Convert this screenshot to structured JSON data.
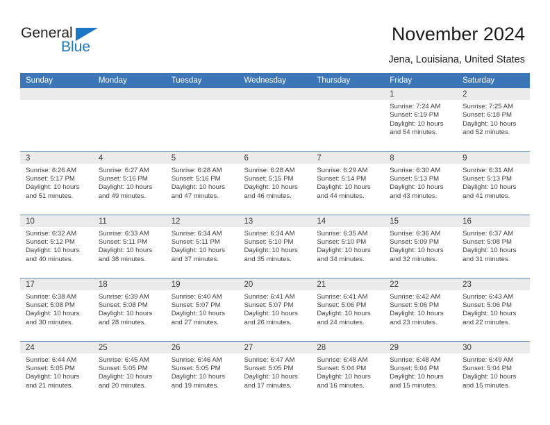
{
  "brand": {
    "name_part1": "General",
    "name_part2": "Blue",
    "logo_icon": "triangle-icon",
    "accent_color": "#1b77c4"
  },
  "header": {
    "title": "November 2024",
    "location": "Jena, Louisiana, United States"
  },
  "theme": {
    "header_blue": "#3a76b8",
    "daynum_band": "#ebebeb",
    "row_divider": "#5b87b8",
    "text": "#3c3c3c"
  },
  "calendar": {
    "weekday_headers": [
      "Sunday",
      "Monday",
      "Tuesday",
      "Wednesday",
      "Thursday",
      "Friday",
      "Saturday"
    ],
    "weeks": [
      [
        {
          "day": "",
          "empty": true
        },
        {
          "day": "",
          "empty": true
        },
        {
          "day": "",
          "empty": true
        },
        {
          "day": "",
          "empty": true
        },
        {
          "day": "",
          "empty": true
        },
        {
          "day": "1",
          "sunrise": "Sunrise: 7:24 AM",
          "sunset": "Sunset: 6:19 PM",
          "daylight1": "Daylight: 10 hours",
          "daylight2": "and 54 minutes."
        },
        {
          "day": "2",
          "sunrise": "Sunrise: 7:25 AM",
          "sunset": "Sunset: 6:18 PM",
          "daylight1": "Daylight: 10 hours",
          "daylight2": "and 52 minutes."
        }
      ],
      [
        {
          "day": "3",
          "sunrise": "Sunrise: 6:26 AM",
          "sunset": "Sunset: 5:17 PM",
          "daylight1": "Daylight: 10 hours",
          "daylight2": "and 51 minutes."
        },
        {
          "day": "4",
          "sunrise": "Sunrise: 6:27 AM",
          "sunset": "Sunset: 5:16 PM",
          "daylight1": "Daylight: 10 hours",
          "daylight2": "and 49 minutes."
        },
        {
          "day": "5",
          "sunrise": "Sunrise: 6:28 AM",
          "sunset": "Sunset: 5:16 PM",
          "daylight1": "Daylight: 10 hours",
          "daylight2": "and 47 minutes."
        },
        {
          "day": "6",
          "sunrise": "Sunrise: 6:28 AM",
          "sunset": "Sunset: 5:15 PM",
          "daylight1": "Daylight: 10 hours",
          "daylight2": "and 46 minutes."
        },
        {
          "day": "7",
          "sunrise": "Sunrise: 6:29 AM",
          "sunset": "Sunset: 5:14 PM",
          "daylight1": "Daylight: 10 hours",
          "daylight2": "and 44 minutes."
        },
        {
          "day": "8",
          "sunrise": "Sunrise: 6:30 AM",
          "sunset": "Sunset: 5:13 PM",
          "daylight1": "Daylight: 10 hours",
          "daylight2": "and 43 minutes."
        },
        {
          "day": "9",
          "sunrise": "Sunrise: 6:31 AM",
          "sunset": "Sunset: 5:13 PM",
          "daylight1": "Daylight: 10 hours",
          "daylight2": "and 41 minutes."
        }
      ],
      [
        {
          "day": "10",
          "sunrise": "Sunrise: 6:32 AM",
          "sunset": "Sunset: 5:12 PM",
          "daylight1": "Daylight: 10 hours",
          "daylight2": "and 40 minutes."
        },
        {
          "day": "11",
          "sunrise": "Sunrise: 6:33 AM",
          "sunset": "Sunset: 5:11 PM",
          "daylight1": "Daylight: 10 hours",
          "daylight2": "and 38 minutes."
        },
        {
          "day": "12",
          "sunrise": "Sunrise: 6:34 AM",
          "sunset": "Sunset: 5:11 PM",
          "daylight1": "Daylight: 10 hours",
          "daylight2": "and 37 minutes."
        },
        {
          "day": "13",
          "sunrise": "Sunrise: 6:34 AM",
          "sunset": "Sunset: 5:10 PM",
          "daylight1": "Daylight: 10 hours",
          "daylight2": "and 35 minutes."
        },
        {
          "day": "14",
          "sunrise": "Sunrise: 6:35 AM",
          "sunset": "Sunset: 5:10 PM",
          "daylight1": "Daylight: 10 hours",
          "daylight2": "and 34 minutes."
        },
        {
          "day": "15",
          "sunrise": "Sunrise: 6:36 AM",
          "sunset": "Sunset: 5:09 PM",
          "daylight1": "Daylight: 10 hours",
          "daylight2": "and 32 minutes."
        },
        {
          "day": "16",
          "sunrise": "Sunrise: 6:37 AM",
          "sunset": "Sunset: 5:08 PM",
          "daylight1": "Daylight: 10 hours",
          "daylight2": "and 31 minutes."
        }
      ],
      [
        {
          "day": "17",
          "sunrise": "Sunrise: 6:38 AM",
          "sunset": "Sunset: 5:08 PM",
          "daylight1": "Daylight: 10 hours",
          "daylight2": "and 30 minutes."
        },
        {
          "day": "18",
          "sunrise": "Sunrise: 6:39 AM",
          "sunset": "Sunset: 5:08 PM",
          "daylight1": "Daylight: 10 hours",
          "daylight2": "and 28 minutes."
        },
        {
          "day": "19",
          "sunrise": "Sunrise: 6:40 AM",
          "sunset": "Sunset: 5:07 PM",
          "daylight1": "Daylight: 10 hours",
          "daylight2": "and 27 minutes."
        },
        {
          "day": "20",
          "sunrise": "Sunrise: 6:41 AM",
          "sunset": "Sunset: 5:07 PM",
          "daylight1": "Daylight: 10 hours",
          "daylight2": "and 26 minutes."
        },
        {
          "day": "21",
          "sunrise": "Sunrise: 6:41 AM",
          "sunset": "Sunset: 5:06 PM",
          "daylight1": "Daylight: 10 hours",
          "daylight2": "and 24 minutes."
        },
        {
          "day": "22",
          "sunrise": "Sunrise: 6:42 AM",
          "sunset": "Sunset: 5:06 PM",
          "daylight1": "Daylight: 10 hours",
          "daylight2": "and 23 minutes."
        },
        {
          "day": "23",
          "sunrise": "Sunrise: 6:43 AM",
          "sunset": "Sunset: 5:06 PM",
          "daylight1": "Daylight: 10 hours",
          "daylight2": "and 22 minutes."
        }
      ],
      [
        {
          "day": "24",
          "sunrise": "Sunrise: 6:44 AM",
          "sunset": "Sunset: 5:05 PM",
          "daylight1": "Daylight: 10 hours",
          "daylight2": "and 21 minutes."
        },
        {
          "day": "25",
          "sunrise": "Sunrise: 6:45 AM",
          "sunset": "Sunset: 5:05 PM",
          "daylight1": "Daylight: 10 hours",
          "daylight2": "and 20 minutes."
        },
        {
          "day": "26",
          "sunrise": "Sunrise: 6:46 AM",
          "sunset": "Sunset: 5:05 PM",
          "daylight1": "Daylight: 10 hours",
          "daylight2": "and 19 minutes."
        },
        {
          "day": "27",
          "sunrise": "Sunrise: 6:47 AM",
          "sunset": "Sunset: 5:05 PM",
          "daylight1": "Daylight: 10 hours",
          "daylight2": "and 17 minutes."
        },
        {
          "day": "28",
          "sunrise": "Sunrise: 6:48 AM",
          "sunset": "Sunset: 5:04 PM",
          "daylight1": "Daylight: 10 hours",
          "daylight2": "and 16 minutes."
        },
        {
          "day": "29",
          "sunrise": "Sunrise: 6:48 AM",
          "sunset": "Sunset: 5:04 PM",
          "daylight1": "Daylight: 10 hours",
          "daylight2": "and 15 minutes."
        },
        {
          "day": "30",
          "sunrise": "Sunrise: 6:49 AM",
          "sunset": "Sunset: 5:04 PM",
          "daylight1": "Daylight: 10 hours",
          "daylight2": "and 15 minutes."
        }
      ]
    ]
  }
}
